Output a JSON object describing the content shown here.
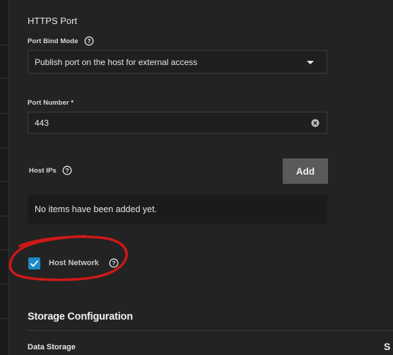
{
  "section": {
    "title": "HTTPS Port"
  },
  "bind_mode": {
    "label": "Port Bind Mode",
    "value": "Publish port on the host for external access",
    "help_icon": "help-circle-icon",
    "dropdown_icon": "caret-down-icon"
  },
  "port_number": {
    "label": "Port Number *",
    "value": "443",
    "clear_icon": "clear-circle-icon"
  },
  "host_ips": {
    "label": "Host IPs",
    "help_icon": "help-circle-icon",
    "add_label": "Add",
    "empty_text": "No items have been added yet."
  },
  "host_network": {
    "label": "Host Network",
    "checked": true,
    "help_icon": "help-circle-icon"
  },
  "storage": {
    "title": "Storage Configuration",
    "data_storage_label": "Data Storage",
    "cut_text": "S"
  },
  "colors": {
    "background": "#232323",
    "accent": "#1d8ac7",
    "button": "#5a5a5a",
    "annotation": "#d01818"
  }
}
